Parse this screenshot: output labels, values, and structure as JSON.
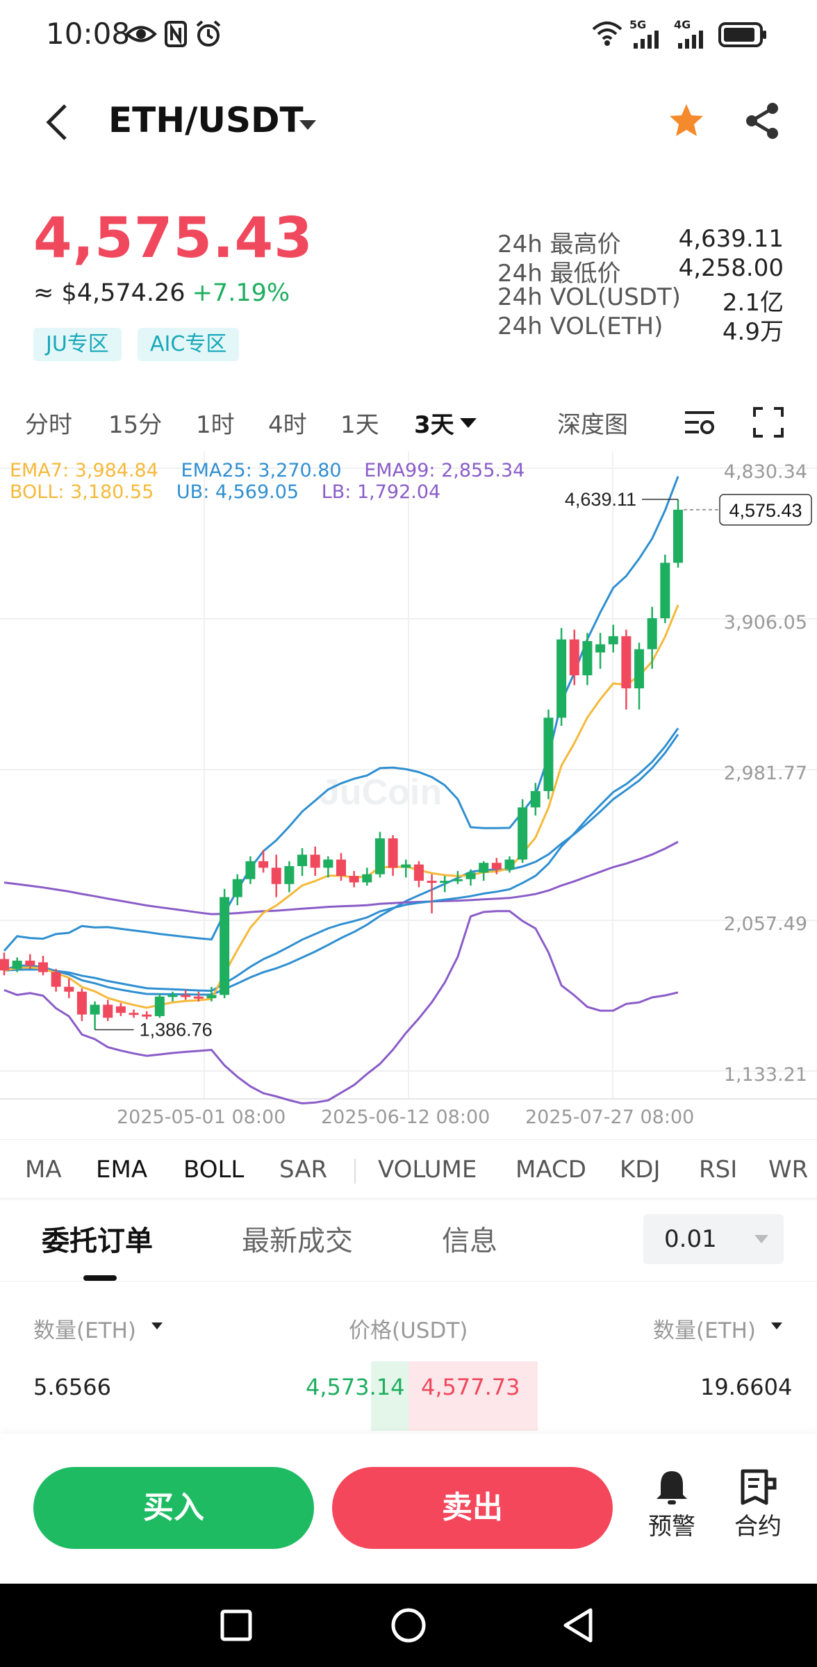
{
  "status_bar": {
    "time": "10:08",
    "net1": "5G",
    "net2": "4G"
  },
  "header": {
    "pair": "ETH/USDT",
    "icons": [
      "back-arrow-icon",
      "dropdown-caret-icon",
      "star-icon",
      "share-icon"
    ],
    "favorite_color": "#f58a2c"
  },
  "price": {
    "last": "4,575.43",
    "usd": "≈ $4,574.26",
    "change": "+7.19%",
    "up_color": "#1eae5f",
    "down_color": "#f0485c"
  },
  "zones": [
    "JU专区",
    "AIC专区"
  ],
  "stats": [
    {
      "label": "24h 最高价",
      "value": "4,639.11"
    },
    {
      "label": "24h 最低价",
      "value": "4,258.00"
    },
    {
      "label": "24h VOL(USDT)",
      "value": "2.1亿"
    },
    {
      "label": "24h VOL(ETH)",
      "value": "4.9万"
    }
  ],
  "periods": [
    "分时",
    "15分",
    "1时",
    "4时",
    "1天",
    "3天"
  ],
  "active_period": "3天",
  "depth_label": "深度图",
  "chart": {
    "ema7": "EMA7: 3,984.84",
    "ema25": "EMA25: 3,270.80",
    "ema99": "EMA99: 2,855.34",
    "boll": "BOLL: 3,180.55",
    "ub": "UB: 4,569.05",
    "lb": "LB: 1,792.04",
    "y_ticks": [
      "4,830.34",
      "3,906.05",
      "2,981.77",
      "2,057.49",
      "1,133.21"
    ],
    "x_ticks": [
      "2025-05-01 08:00",
      "2025-06-12 08:00",
      "2025-07-27 08:00"
    ],
    "high_marker": "4,639.11",
    "low_marker": "1,386.76",
    "last_marker": "4,575.43",
    "watermark": "JuCoin"
  },
  "chart_data": {
    "type": "candlestick",
    "interval": "3天",
    "ylim": [
      1133.21,
      4830.34
    ],
    "y_ticks": [
      4830.34,
      3906.05,
      2981.77,
      2057.49,
      1133.21
    ],
    "x_ticks": [
      "2025-05-01 08:00",
      "2025-06-12 08:00",
      "2025-07-27 08:00"
    ],
    "candles": [
      {
        "o": 1820,
        "h": 1860,
        "l": 1720,
        "c": 1750
      },
      {
        "o": 1760,
        "h": 1830,
        "l": 1740,
        "c": 1810
      },
      {
        "o": 1810,
        "h": 1850,
        "l": 1760,
        "c": 1780
      },
      {
        "o": 1800,
        "h": 1840,
        "l": 1720,
        "c": 1740
      },
      {
        "o": 1740,
        "h": 1760,
        "l": 1620,
        "c": 1650
      },
      {
        "o": 1650,
        "h": 1700,
        "l": 1580,
        "c": 1620
      },
      {
        "o": 1620,
        "h": 1640,
        "l": 1440,
        "c": 1480
      },
      {
        "o": 1480,
        "h": 1560,
        "l": 1386.76,
        "c": 1540
      },
      {
        "o": 1540,
        "h": 1570,
        "l": 1440,
        "c": 1460
      },
      {
        "o": 1530,
        "h": 1550,
        "l": 1470,
        "c": 1490
      },
      {
        "o": 1490,
        "h": 1510,
        "l": 1460,
        "c": 1480
      },
      {
        "o": 1480,
        "h": 1500,
        "l": 1450,
        "c": 1470
      },
      {
        "o": 1470,
        "h": 1610,
        "l": 1460,
        "c": 1590
      },
      {
        "o": 1590,
        "h": 1620,
        "l": 1560,
        "c": 1600
      },
      {
        "o": 1600,
        "h": 1630,
        "l": 1570,
        "c": 1590
      },
      {
        "o": 1590,
        "h": 1620,
        "l": 1560,
        "c": 1580
      },
      {
        "o": 1580,
        "h": 1650,
        "l": 1560,
        "c": 1600
      },
      {
        "o": 1600,
        "h": 2250,
        "l": 1580,
        "c": 2200
      },
      {
        "o": 2200,
        "h": 2340,
        "l": 2150,
        "c": 2310
      },
      {
        "o": 2310,
        "h": 2450,
        "l": 2280,
        "c": 2420
      },
      {
        "o": 2420,
        "h": 2490,
        "l": 2350,
        "c": 2380
      },
      {
        "o": 2380,
        "h": 2460,
        "l": 2200,
        "c": 2280
      },
      {
        "o": 2280,
        "h": 2420,
        "l": 2230,
        "c": 2390
      },
      {
        "o": 2390,
        "h": 2500,
        "l": 2330,
        "c": 2460
      },
      {
        "o": 2460,
        "h": 2510,
        "l": 2330,
        "c": 2380
      },
      {
        "o": 2380,
        "h": 2450,
        "l": 2320,
        "c": 2430
      },
      {
        "o": 2430,
        "h": 2470,
        "l": 2300,
        "c": 2330
      },
      {
        "o": 2330,
        "h": 2360,
        "l": 2260,
        "c": 2290
      },
      {
        "o": 2290,
        "h": 2380,
        "l": 2270,
        "c": 2340
      },
      {
        "o": 2340,
        "h": 2600,
        "l": 2320,
        "c": 2560
      },
      {
        "o": 2560,
        "h": 2580,
        "l": 2330,
        "c": 2380
      },
      {
        "o": 2380,
        "h": 2430,
        "l": 2320,
        "c": 2400
      },
      {
        "o": 2400,
        "h": 2420,
        "l": 2260,
        "c": 2300
      },
      {
        "o": 2300,
        "h": 2340,
        "l": 2100,
        "c": 2290
      },
      {
        "o": 2290,
        "h": 2330,
        "l": 2230,
        "c": 2300
      },
      {
        "o": 2300,
        "h": 2360,
        "l": 2280,
        "c": 2310
      },
      {
        "o": 2310,
        "h": 2370,
        "l": 2270,
        "c": 2350
      },
      {
        "o": 2350,
        "h": 2420,
        "l": 2300,
        "c": 2410
      },
      {
        "o": 2410,
        "h": 2440,
        "l": 2340,
        "c": 2370
      },
      {
        "o": 2370,
        "h": 2450,
        "l": 2350,
        "c": 2430
      },
      {
        "o": 2430,
        "h": 2800,
        "l": 2410,
        "c": 2750
      },
      {
        "o": 2750,
        "h": 2900,
        "l": 2700,
        "c": 2850
      },
      {
        "o": 2850,
        "h": 3350,
        "l": 2800,
        "c": 3300
      },
      {
        "o": 3300,
        "h": 3850,
        "l": 3250,
        "c": 3780
      },
      {
        "o": 3780,
        "h": 3840,
        "l": 3500,
        "c": 3560
      },
      {
        "o": 3560,
        "h": 3820,
        "l": 3500,
        "c": 3770
      },
      {
        "o": 3700,
        "h": 3820,
        "l": 3600,
        "c": 3750
      },
      {
        "o": 3750,
        "h": 3870,
        "l": 3700,
        "c": 3800
      },
      {
        "o": 3800,
        "h": 3840,
        "l": 3350,
        "c": 3480
      },
      {
        "o": 3480,
        "h": 3760,
        "l": 3350,
        "c": 3720
      },
      {
        "o": 3720,
        "h": 3980,
        "l": 3600,
        "c": 3910
      },
      {
        "o": 3910,
        "h": 4300,
        "l": 3880,
        "c": 4250
      },
      {
        "o": 4250,
        "h": 4639.11,
        "l": 4220,
        "c": 4575.43
      }
    ],
    "ema7_last": 3984.84,
    "ema25_last": 3270.8,
    "ema99_last": 2855.34,
    "boll_last": 3180.55,
    "ub_last": 4569.05,
    "lb_last": 1792.04
  },
  "indicators": [
    "MA",
    "EMA",
    "BOLL",
    "SAR",
    "VOLUME",
    "MACD",
    "KDJ",
    "RSI",
    "WR"
  ],
  "book_tabs": [
    "委托订单",
    "最新成交",
    "信息"
  ],
  "precision": "0.01",
  "orderbook": {
    "headers": [
      "数量(ETH)",
      "价格(USDT)",
      "数量(ETH)"
    ],
    "rows": [
      {
        "bid_qty": "5.6566",
        "bid_price": "4,573.14",
        "ask_price": "4,577.73",
        "ask_qty": "19.6604"
      }
    ]
  },
  "actions": {
    "buy": "买入",
    "sell": "卖出",
    "alert": "预警",
    "contract": "合约"
  }
}
